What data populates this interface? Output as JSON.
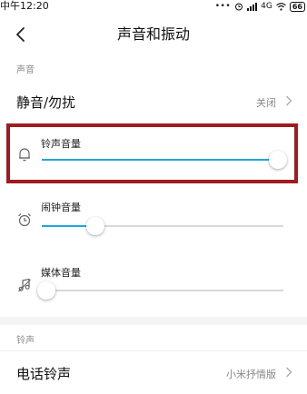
{
  "status_bar": {
    "time": "中午12:20",
    "dots": "•••",
    "network": "4G",
    "battery": "66"
  },
  "header": {
    "title": "声音和振动"
  },
  "section_sound": {
    "label": "声音"
  },
  "dnd": {
    "label": "静音/勿扰",
    "value": "关闭"
  },
  "volumes": [
    {
      "label": "铃声音量",
      "icon": "bell-icon",
      "level": 0.98
    },
    {
      "label": "闹钟音量",
      "icon": "alarm-clock-icon",
      "level": 0.22
    },
    {
      "label": "媒体音量",
      "icon": "music-note-icon",
      "level": 0.02
    }
  ],
  "section_ringtone": {
    "label": "铃声"
  },
  "phone_ringtone": {
    "label": "电话铃声",
    "value": "小米抒情版"
  },
  "colors": {
    "accent": "#1fa7d9",
    "highlight": "#a01a21"
  }
}
